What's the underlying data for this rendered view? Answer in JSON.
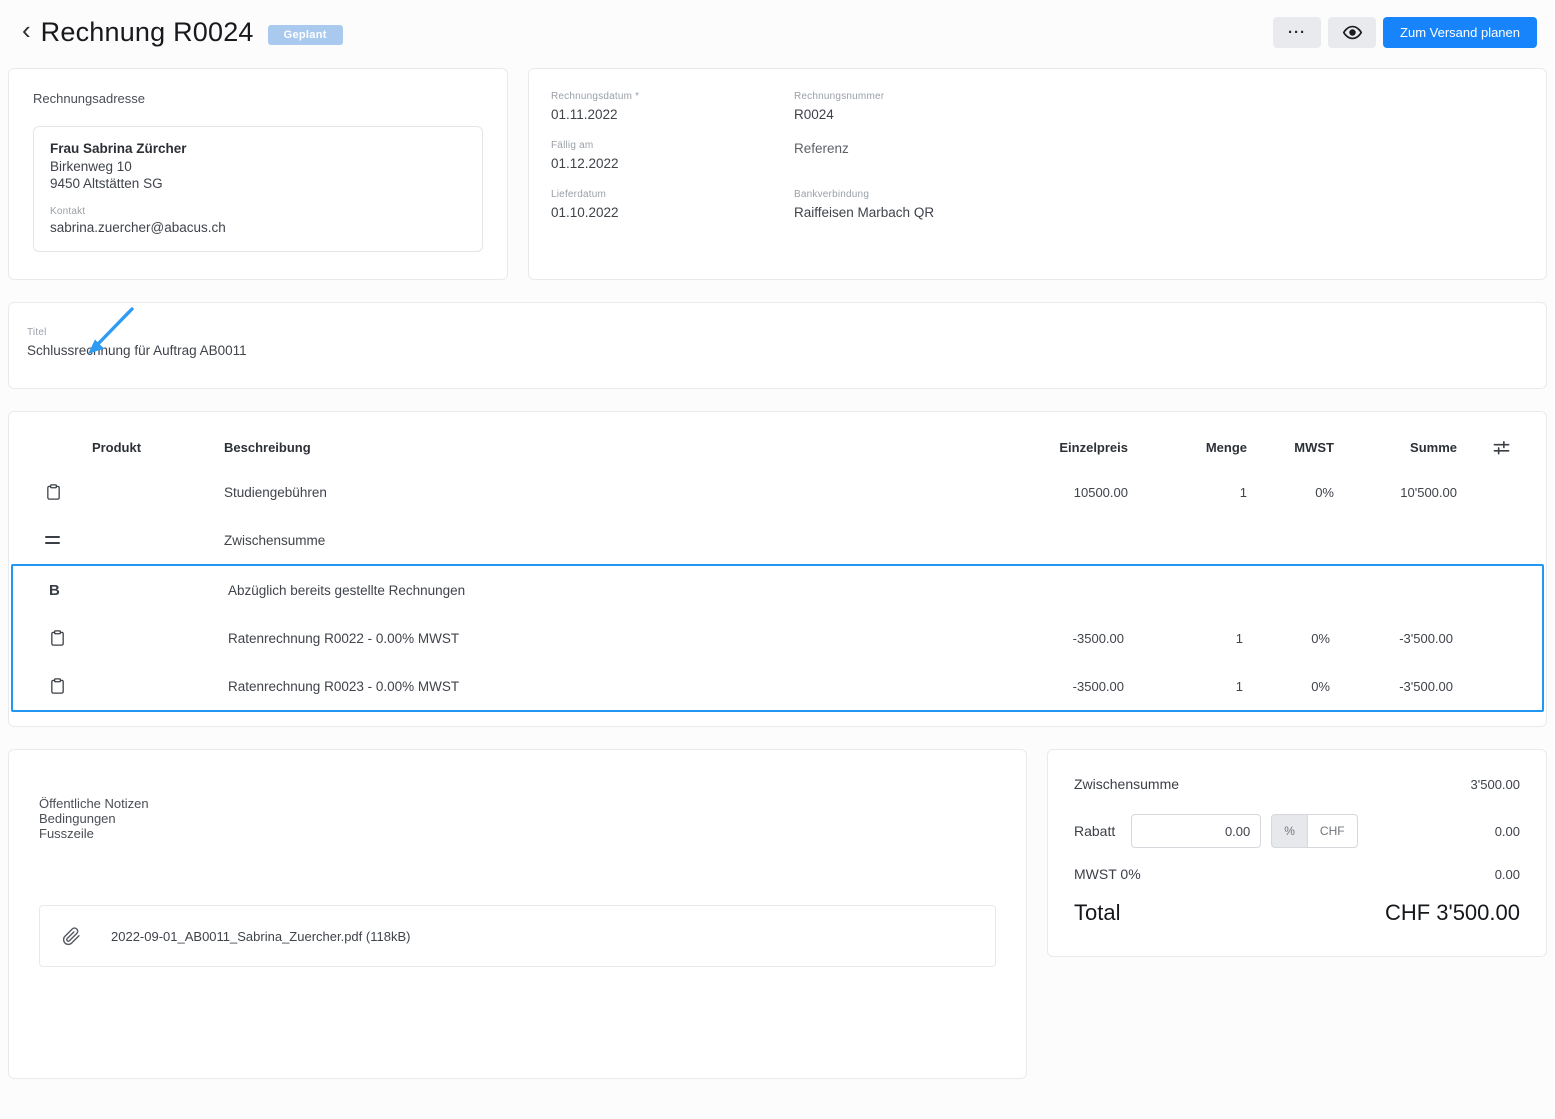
{
  "header": {
    "back_icon": "‹",
    "title": "Rechnung R0024",
    "status": "Geplant",
    "more_label": "···",
    "primary_button": "Zum Versand planen"
  },
  "address_card": {
    "section_label": "Rechnungsadresse",
    "name": "Frau Sabrina Zürcher",
    "address_line1": "Birkenweg 10",
    "address_line2": "9450 Altstätten SG",
    "contact_label": "Kontakt",
    "contact_email": "sabrina.zuercher@abacus.ch"
  },
  "details_card": {
    "fields": [
      {
        "label": "Rechnungsdatum *",
        "value": "01.11.2022"
      },
      {
        "label": "Rechnungsnummer",
        "value": "R0024"
      },
      {
        "label": "Fällig am",
        "value": "01.12.2022"
      },
      {
        "label": "Referenz",
        "value": ""
      },
      {
        "label": "Lieferdatum",
        "value": "01.10.2022"
      },
      {
        "label": "Bankverbindung",
        "value": "Raiffeisen Marbach QR"
      }
    ]
  },
  "title_card": {
    "label": "Titel",
    "value": "Schlussrechnung für Auftrag AB0011"
  },
  "items_table": {
    "headers": {
      "product": "Produkt",
      "description": "Beschreibung",
      "unit_price": "Einzelpreis",
      "quantity": "Menge",
      "vat": "MWST",
      "total": "Summe"
    },
    "rows": [
      {
        "icon": "clipboard",
        "description": "Studiengebühren",
        "unit_price": "10500.00",
        "quantity": "1",
        "vat": "0%",
        "total": "10'500.00"
      },
      {
        "icon": "subtotal",
        "description": "Zwischensumme",
        "unit_price": "",
        "quantity": "",
        "vat": "",
        "total": ""
      },
      {
        "icon": "bold-text",
        "icon_label": "B",
        "description": "Abzüglich bereits gestellte Rechnungen",
        "unit_price": "",
        "quantity": "",
        "vat": "",
        "total": ""
      },
      {
        "icon": "clipboard",
        "description": "Ratenrechnung R0022 - 0.00% MWST",
        "unit_price": "-3500.00",
        "quantity": "1",
        "vat": "0%",
        "total": "-3'500.00"
      },
      {
        "icon": "clipboard",
        "description": "Ratenrechnung R0023 - 0.00% MWST",
        "unit_price": "-3500.00",
        "quantity": "1",
        "vat": "0%",
        "total": "-3'500.00"
      }
    ]
  },
  "notes_card": {
    "public_notes_label": "Öffentliche Notizen",
    "terms_label": "Bedingungen",
    "footer_label": "Fusszeile",
    "attachment_name": "2022-09-01_AB0011_Sabrina_Zuercher.pdf (118kB)"
  },
  "totals_card": {
    "subtotal_label": "Zwischensumme",
    "subtotal_value": "3'500.00",
    "discount_label": "Rabatt",
    "discount_input": "0.00",
    "unit_percent": "%",
    "unit_chf": "CHF",
    "discount_value": "0.00",
    "vat_label": "MWST 0%",
    "vat_value": "0.00",
    "total_label": "Total",
    "total_value": "CHF 3'500.00"
  },
  "colors": {
    "accent": "#1784fb",
    "badge_bg": "#a9c9ee",
    "highlight_border": "#2196f3",
    "annotation_arrow": "#2e9cf5"
  }
}
